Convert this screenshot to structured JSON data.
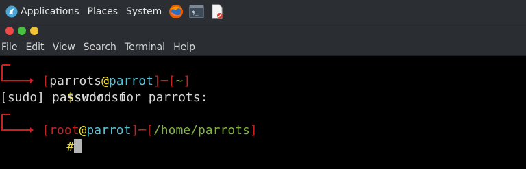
{
  "panel": {
    "applications": "Applications",
    "places": "Places",
    "system": "System",
    "launchers": [
      "firefox-icon",
      "terminal-icon",
      "text-editor-icon"
    ]
  },
  "window": {
    "buttons": [
      "close",
      "maximize",
      "minimize"
    ],
    "menu": [
      "File",
      "Edit",
      "View",
      "Search",
      "Terminal",
      "Help"
    ]
  },
  "terminal": {
    "prompt1": {
      "open": "[",
      "user": "parrots",
      "at": "@",
      "host": "parrot",
      "close": "]",
      "dash": "─",
      "dir_open": "[",
      "dir": "~",
      "dir_close": "]"
    },
    "cmd1": {
      "symbol": "$",
      "text": "sudo su"
    },
    "output1": "[sudo] password for parrots:",
    "prompt2": {
      "open": "[",
      "user": "root",
      "at": "@",
      "host": "parrot",
      "close": "]",
      "dash": "─",
      "dir_open": "[",
      "dir": "/home/parrots",
      "dir_close": "]"
    },
    "cmd2": {
      "symbol": "#"
    }
  }
}
